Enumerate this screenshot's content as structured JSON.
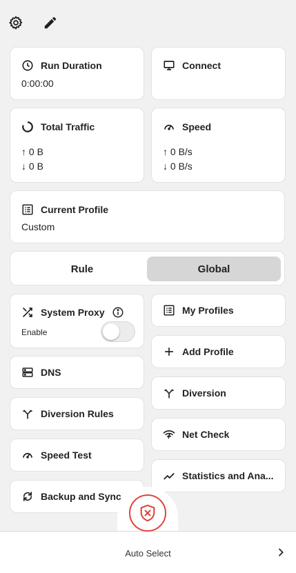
{
  "toolbar": {
    "settings_icon": "gear-icon",
    "edit_icon": "pencil-icon"
  },
  "stats": {
    "run_duration": {
      "label": "Run Duration",
      "value": "0:00:00",
      "icon": "clock-icon"
    },
    "connect": {
      "label": "Connect",
      "icon": "monitor-icon"
    },
    "total_traffic": {
      "label": "Total Traffic",
      "up": "↑ 0 B",
      "down": "↓ 0 B",
      "icon": "circle-progress-icon"
    },
    "speed": {
      "label": "Speed",
      "up": "↑ 0 B/s",
      "down": "↓ 0 B/s",
      "icon": "speedometer-icon"
    }
  },
  "current_profile": {
    "label": "Current Profile",
    "value": "Custom",
    "icon": "list-icon"
  },
  "mode": {
    "options": [
      "Rule",
      "Global"
    ],
    "selected": "Global"
  },
  "left_tiles": {
    "system_proxy": {
      "label": "System Proxy",
      "enable_label": "Enable",
      "enabled": false
    },
    "dns": "DNS",
    "diversion_rules": "Diversion Rules",
    "speed_test": "Speed Test",
    "backup_sync": "Backup and Sync"
  },
  "right_tiles": {
    "my_profiles": "My Profiles",
    "add_profile": "Add Profile",
    "diversion": "Diversion",
    "net_check": "Net Check",
    "statistics": "Statistics and Ana..."
  },
  "bottom": {
    "label": "Auto Select"
  },
  "colors": {
    "accent": "#e0453a",
    "selected_segment": "#d6d6d6"
  }
}
